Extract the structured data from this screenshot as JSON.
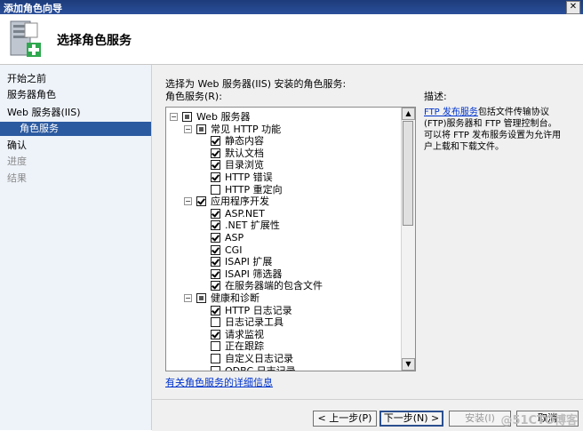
{
  "window": {
    "title": "添加角色向导",
    "close_glyph": "✕"
  },
  "header": {
    "title": "选择角色服务",
    "icon": "server-add-icon"
  },
  "nav": {
    "items": [
      {
        "label": "开始之前",
        "state": "normal"
      },
      {
        "label": "服务器角色",
        "state": "normal"
      },
      {
        "label": "Web 服务器(IIS)",
        "state": "normal"
      },
      {
        "label": "角色服务",
        "state": "selected"
      },
      {
        "label": "确认",
        "state": "normal"
      },
      {
        "label": "进度",
        "state": "disabled"
      },
      {
        "label": "结果",
        "state": "disabled"
      }
    ]
  },
  "main": {
    "instruction": "选择为 Web 服务器(IIS) 安装的角色服务:",
    "tree_label": "角色服务(R):",
    "desc_label": "描述:",
    "desc_link": "FTP 发布服务",
    "desc_text_1": "包括文件传输协议",
    "desc_text_2": "(FTP)服务器和 FTP 管理控制台。",
    "desc_text_3": "可以将 FTP 发布服务设置为允许用",
    "desc_text_4": "户上载和下载文件。",
    "more_link": "有关角色服务的详细信息"
  },
  "tree": [
    {
      "label": "Web 服务器",
      "level": 0,
      "expander": "⊟",
      "check": "part"
    },
    {
      "label": "常见 HTTP 功能",
      "level": 1,
      "expander": "⊟",
      "check": "part"
    },
    {
      "label": "静态内容",
      "level": 2,
      "check": "on"
    },
    {
      "label": "默认文档",
      "level": 2,
      "check": "on"
    },
    {
      "label": "目录浏览",
      "level": 2,
      "check": "on"
    },
    {
      "label": "HTTP 错误",
      "level": 2,
      "check": "on"
    },
    {
      "label": "HTTP 重定向",
      "level": 2,
      "check": "off"
    },
    {
      "label": "应用程序开发",
      "level": 1,
      "expander": "⊟",
      "check": "on"
    },
    {
      "label": "ASP.NET",
      "level": 2,
      "check": "on"
    },
    {
      "label": ".NET 扩展性",
      "level": 2,
      "check": "on"
    },
    {
      "label": "ASP",
      "level": 2,
      "check": "on"
    },
    {
      "label": "CGI",
      "level": 2,
      "check": "on"
    },
    {
      "label": "ISAPI 扩展",
      "level": 2,
      "check": "on"
    },
    {
      "label": "ISAPI 筛选器",
      "level": 2,
      "check": "on"
    },
    {
      "label": "在服务器端的包含文件",
      "level": 2,
      "check": "on"
    },
    {
      "label": "健康和诊断",
      "level": 1,
      "expander": "⊟",
      "check": "part"
    },
    {
      "label": "HTTP 日志记录",
      "level": 2,
      "check": "on"
    },
    {
      "label": "日志记录工具",
      "level": 2,
      "check": "off"
    },
    {
      "label": "请求监视",
      "level": 2,
      "check": "on"
    },
    {
      "label": "正在跟踪",
      "level": 2,
      "check": "off"
    },
    {
      "label": "自定义日志记录",
      "level": 2,
      "check": "off"
    },
    {
      "label": "ODBC 日志记录",
      "level": 2,
      "check": "off"
    }
  ],
  "footer": {
    "prev_label": "< 上一步(P)",
    "next_label": "下一步(N) >",
    "install_label": "安装(I)",
    "cancel_label": "取消"
  },
  "watermark": "@51CTO博客"
}
